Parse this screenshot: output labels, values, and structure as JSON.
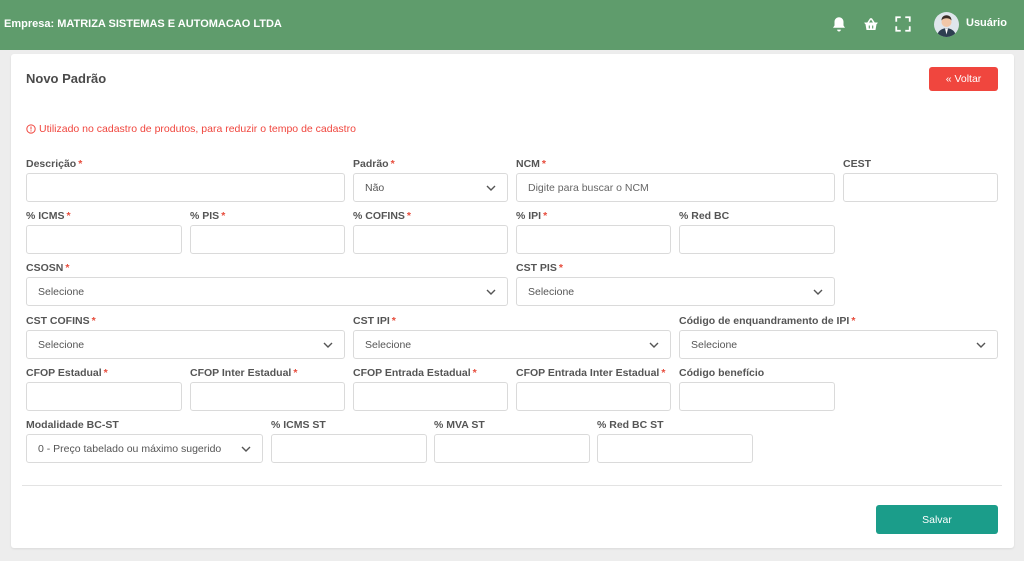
{
  "header": {
    "company": "Empresa: MATRIZA SISTEMAS E AUTOMACAO LTDA",
    "user_name": "Usuário",
    "icons": [
      "bell-icon",
      "basket-icon",
      "fullscreen-icon",
      "avatar"
    ]
  },
  "page": {
    "title": "Novo Padrão",
    "back_label": "« Voltar",
    "info_text": "Utilizado no cadastro de produtos, para reduzir o tempo de cadastro",
    "save_label": "Salvar"
  },
  "colors": {
    "topbar": "#5f9c6c",
    "danger": "#f0463e",
    "primary": "#1b9d8a"
  },
  "fields": {
    "descricao": {
      "label": "Descrição",
      "required": "*",
      "value": ""
    },
    "padrao": {
      "label": "Padrão",
      "required": "*",
      "value": "Não"
    },
    "ncm": {
      "label": "NCM",
      "required": "*",
      "value": "",
      "placeholder": "Digite para buscar o NCM"
    },
    "cest": {
      "label": "CEST",
      "value": ""
    },
    "icms": {
      "label": "% ICMS",
      "required": "*",
      "value": ""
    },
    "pis": {
      "label": "% PIS",
      "required": "*",
      "value": ""
    },
    "cofins": {
      "label": "% COFINS",
      "required": "*",
      "value": ""
    },
    "ipi": {
      "label": "% IPI",
      "required": "*",
      "value": ""
    },
    "red_bc": {
      "label": "% Red BC",
      "value": ""
    },
    "csosn": {
      "label": "CSOSN",
      "required": "*",
      "value": "Selecione"
    },
    "cst_pis": {
      "label": "CST PIS",
      "required": "*",
      "value": "Selecione"
    },
    "cst_cofins": {
      "label": "CST COFINS",
      "required": "*",
      "value": "Selecione"
    },
    "cst_ipi": {
      "label": "CST IPI",
      "required": "*",
      "value": "Selecione"
    },
    "cod_enq_ipi": {
      "label": "Código de enquandramento de IPI",
      "required": "*",
      "value": "Selecione"
    },
    "cfop_estadual": {
      "label": "CFOP Estadual",
      "required": "*",
      "value": ""
    },
    "cfop_inter": {
      "label": "CFOP Inter Estadual",
      "required": "*",
      "value": ""
    },
    "cfop_entrada": {
      "label": "CFOP Entrada Estadual",
      "required": "*",
      "value": ""
    },
    "cfop_entrada_inter": {
      "label": "CFOP Entrada Inter Estadual",
      "required": "*",
      "value": ""
    },
    "cod_beneficio": {
      "label": "Código benefício",
      "value": ""
    },
    "modalidade_bcst": {
      "label": "Modalidade BC-ST",
      "value": "0 - Preço tabelado ou máximo sugerido"
    },
    "icms_st": {
      "label": "% ICMS ST",
      "value": ""
    },
    "mva_st": {
      "label": "% MVA ST",
      "value": ""
    },
    "red_bc_st": {
      "label": "% Red BC ST",
      "value": ""
    }
  }
}
